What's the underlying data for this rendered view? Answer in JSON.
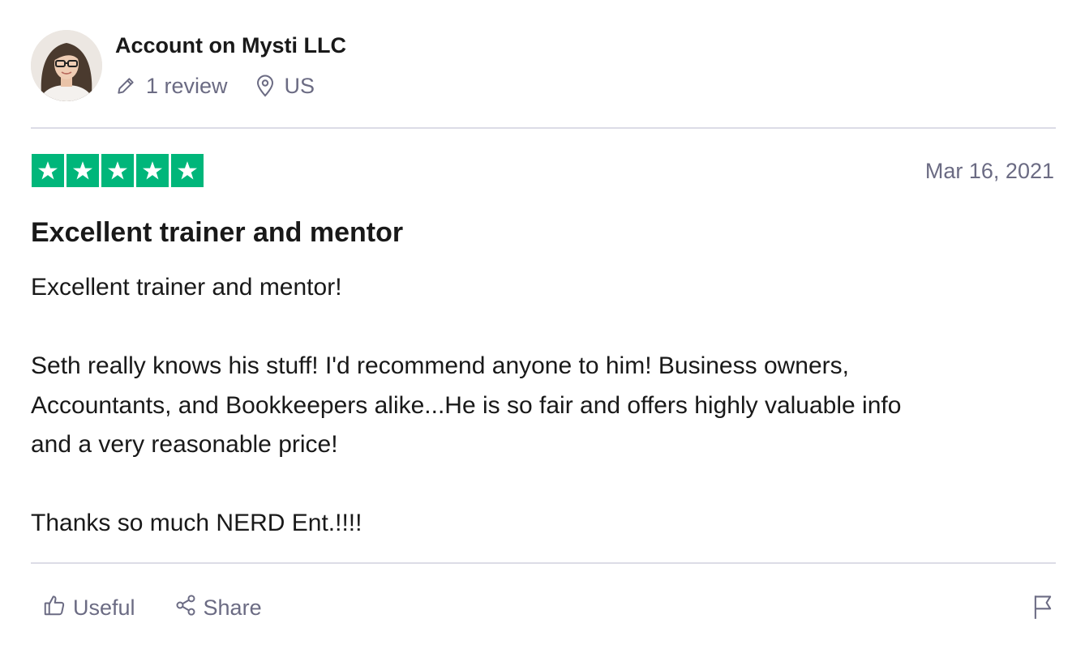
{
  "reviewer": {
    "name": "Account on Mysti LLC",
    "review_count": "1 review",
    "location": "US"
  },
  "review": {
    "rating": 5,
    "rating_max": 5,
    "date": "Mar 16, 2021",
    "title": "Excellent trainer and mentor",
    "paragraphs": [
      "Excellent trainer and mentor!",
      "Seth really knows his stuff! I'd recommend anyone to him! Business owners,\nAccountants, and Bookkeepers alike...He is so fair and offers highly valuable info\nand a very reasonable price!",
      "Thanks so much NERD Ent.!!!!"
    ]
  },
  "actions": {
    "useful_label": "Useful",
    "share_label": "Share"
  },
  "icons": {
    "review_count": "pencil-icon",
    "location": "location-pin-icon",
    "useful": "thumbs-up-icon",
    "share": "share-icon",
    "report": "flag-icon"
  },
  "colors": {
    "star_fill": "#00b67a",
    "muted_text": "#6b6b83",
    "text": "#191919",
    "divider": "#dcdce6"
  }
}
